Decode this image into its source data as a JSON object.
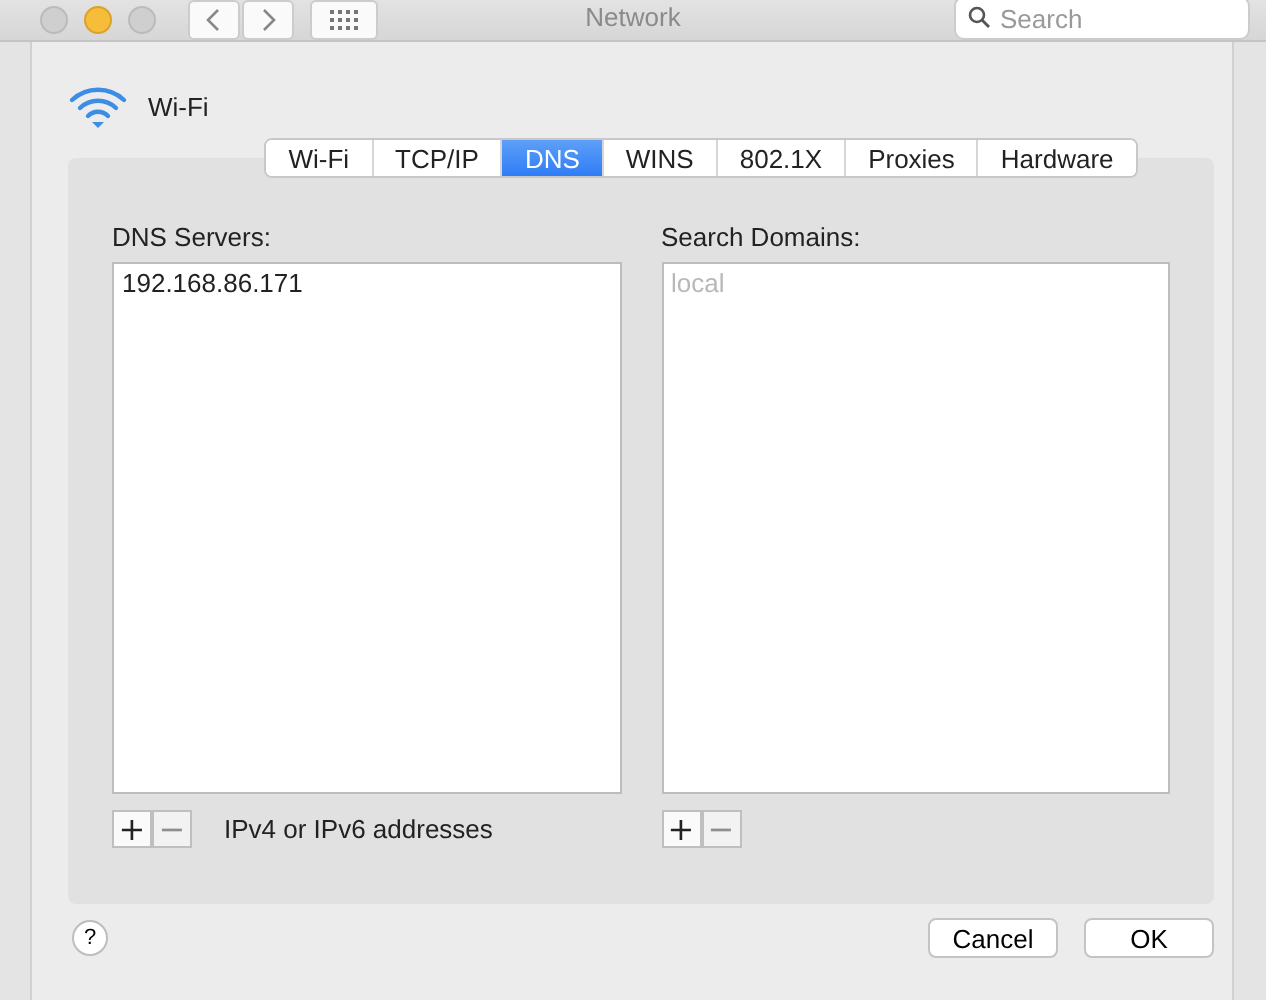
{
  "window": {
    "title": "Network",
    "search": {
      "placeholder": "Search"
    }
  },
  "interface": {
    "name": "Wi-Fi"
  },
  "tabs": [
    {
      "label": "Wi-Fi",
      "selected": false
    },
    {
      "label": "TCP/IP",
      "selected": false
    },
    {
      "label": "DNS",
      "selected": true
    },
    {
      "label": "WINS",
      "selected": false
    },
    {
      "label": "802.1X",
      "selected": false
    },
    {
      "label": "Proxies",
      "selected": false
    },
    {
      "label": "Hardware",
      "selected": false
    }
  ],
  "dns_servers": {
    "label": "DNS Servers:",
    "entries": [
      "192.168.86.171"
    ],
    "add": {
      "label": "+",
      "disabled": false
    },
    "remove": {
      "label": "−",
      "disabled": true
    },
    "hint": "IPv4 or IPv6 addresses"
  },
  "search_domains": {
    "label": "Search Domains:",
    "placeholder": "local",
    "add": {
      "label": "+",
      "disabled": false
    },
    "remove": {
      "label": "−",
      "disabled": true
    }
  },
  "help": {
    "label": "?"
  },
  "buttons": [
    {
      "label": "Cancel"
    },
    {
      "label": "OK"
    }
  ]
}
